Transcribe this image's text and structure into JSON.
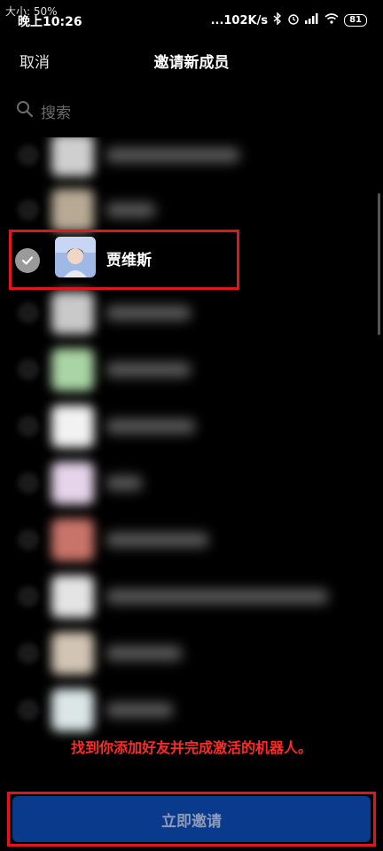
{
  "status_bar": {
    "size_badge": "大小: 50%",
    "time": "晚上10:26",
    "network_speed": "...102K/s",
    "battery": "81"
  },
  "header": {
    "cancel_label": "取消",
    "title": "邀请新成员"
  },
  "search": {
    "placeholder": "搜索"
  },
  "list": {
    "selected_contact": {
      "name": "贾维斯",
      "checked": true
    }
  },
  "annotation": {
    "hint": "找到你添加好友并完成激活的机器人。"
  },
  "footer": {
    "invite_button_label": "立即邀请"
  },
  "colors": {
    "background": "#000000",
    "highlight_border": "#e0161e",
    "hint_text": "#ff2a2a",
    "button_bg": "#0a3a8c",
    "button_text": "#8e9ab8"
  }
}
